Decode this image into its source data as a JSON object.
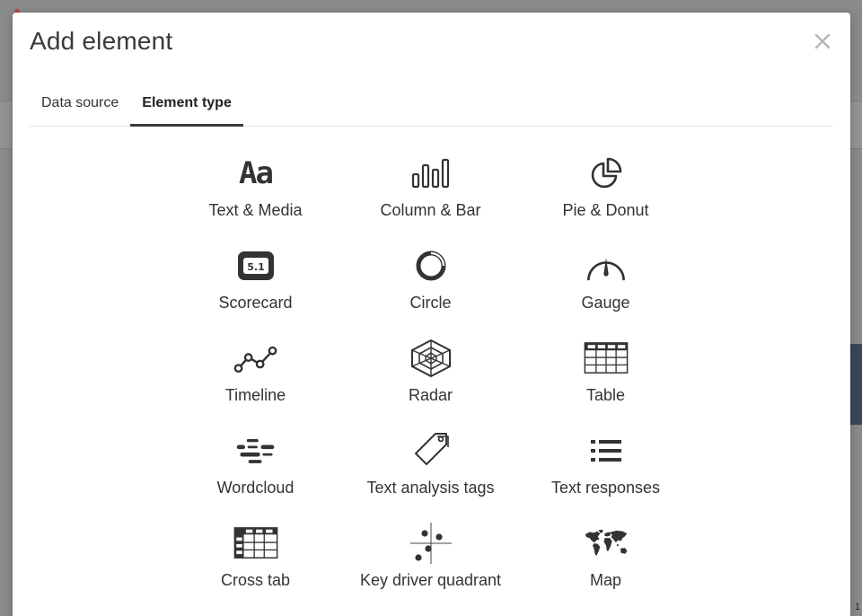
{
  "dialog": {
    "title": "Add element",
    "close_label": "×"
  },
  "tabs": [
    {
      "label": "Data source",
      "active": false
    },
    {
      "label": "Element type",
      "active": true
    }
  ],
  "element_types": [
    {
      "label": "Text & Media",
      "icon": "text-media-icon"
    },
    {
      "label": "Column & Bar",
      "icon": "column-bar-icon"
    },
    {
      "label": "Pie & Donut",
      "icon": "pie-donut-icon"
    },
    {
      "label": "Scorecard",
      "icon": "scorecard-icon",
      "icon_text": "5.1"
    },
    {
      "label": "Circle",
      "icon": "circle-icon"
    },
    {
      "label": "Gauge",
      "icon": "gauge-icon"
    },
    {
      "label": "Timeline",
      "icon": "timeline-icon"
    },
    {
      "label": "Radar",
      "icon": "radar-icon"
    },
    {
      "label": "Table",
      "icon": "table-icon"
    },
    {
      "label": "Wordcloud",
      "icon": "wordcloud-icon"
    },
    {
      "label": "Text analysis tags",
      "icon": "tag-icon"
    },
    {
      "label": "Text responses",
      "icon": "list-icon"
    },
    {
      "label": "Cross tab",
      "icon": "cross-tab-icon"
    },
    {
      "label": "Key driver quadrant",
      "icon": "quadrant-icon"
    },
    {
      "label": "Map",
      "icon": "world-map-icon"
    }
  ],
  "icon_glyph_text_media": "Aa",
  "colors": {
    "icon": "#333333",
    "overlay": "#8a8a8a",
    "tab_underline": "#3b3b3b"
  },
  "background_badge": "1"
}
